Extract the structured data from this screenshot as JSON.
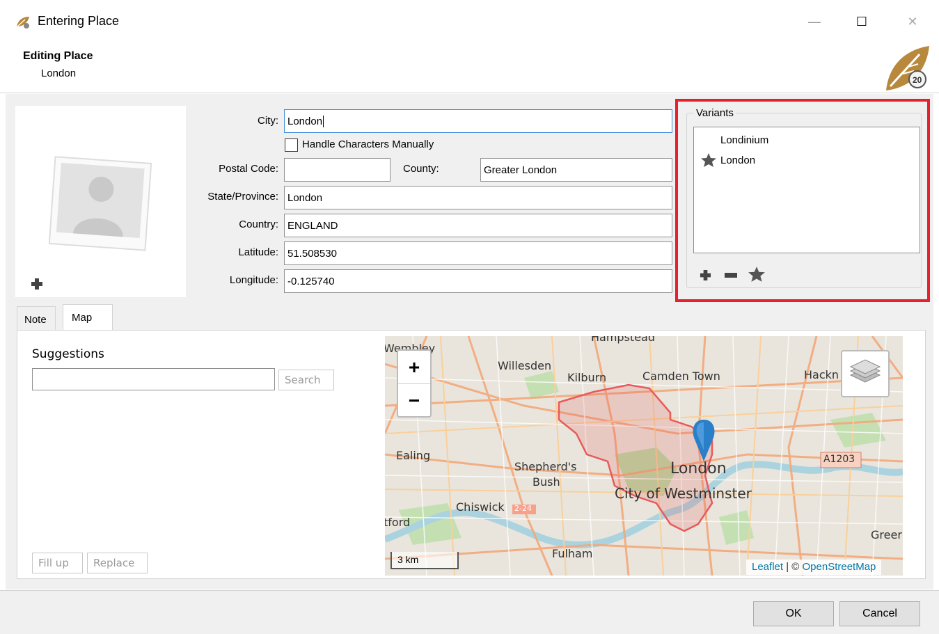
{
  "window": {
    "title": "Entering Place",
    "minimize_glyph": "—",
    "maximize_glyph": "☐",
    "close_glyph": "✕"
  },
  "header": {
    "title": "Editing Place",
    "subtitle": "London"
  },
  "form": {
    "city_label": "City:",
    "city_value": "London",
    "handle_chars_label": "Handle Characters Manually",
    "postal_label": "Postal Code:",
    "postal_value": "",
    "county_label": "County:",
    "county_value": "Greater London",
    "state_label": "State/Province:",
    "state_value": "London",
    "country_label": "Country:",
    "country_value": "ENGLAND",
    "latitude_label": "Latitude:",
    "latitude_value": "51.508530",
    "longitude_label": "Longitude:",
    "longitude_value": "-0.125740"
  },
  "variants": {
    "legend": "Variants",
    "items": [
      {
        "label": "Londinium",
        "primary": false
      },
      {
        "label": "London",
        "primary": true
      }
    ]
  },
  "tabs": [
    {
      "label": "Note",
      "active": false
    },
    {
      "label": "Map",
      "active": true
    }
  ],
  "suggestions": {
    "title": "Suggestions",
    "search_value": "",
    "search_button": "Search",
    "fill_up_button": "Fill up",
    "replace_button": "Replace"
  },
  "map": {
    "zoom_in": "+",
    "zoom_out": "−",
    "scale": "3 km",
    "attribution_leaflet": "Leaflet",
    "attribution_sep": " | © ",
    "attribution_osm": "OpenStreetMap",
    "labels": {
      "wembley": "Wembley",
      "willesden": "Willesden",
      "kilburn": "Kilburn",
      "camden": "Camden Town",
      "hampstead": "Hampstead",
      "hackney": "Hackn",
      "ealing": "Ealing",
      "shepherds1": "Shepherd's",
      "shepherds2": "Bush",
      "london": "London",
      "westminster": "City of Westminster",
      "chiswick": "Chiswick",
      "brentford": "tford",
      "fulham": "Fulham",
      "a1203": "A1203",
      "greenwich": "Greer",
      "road_sign": "2-24"
    }
  },
  "footer": {
    "ok": "OK",
    "cancel": "Cancel"
  }
}
